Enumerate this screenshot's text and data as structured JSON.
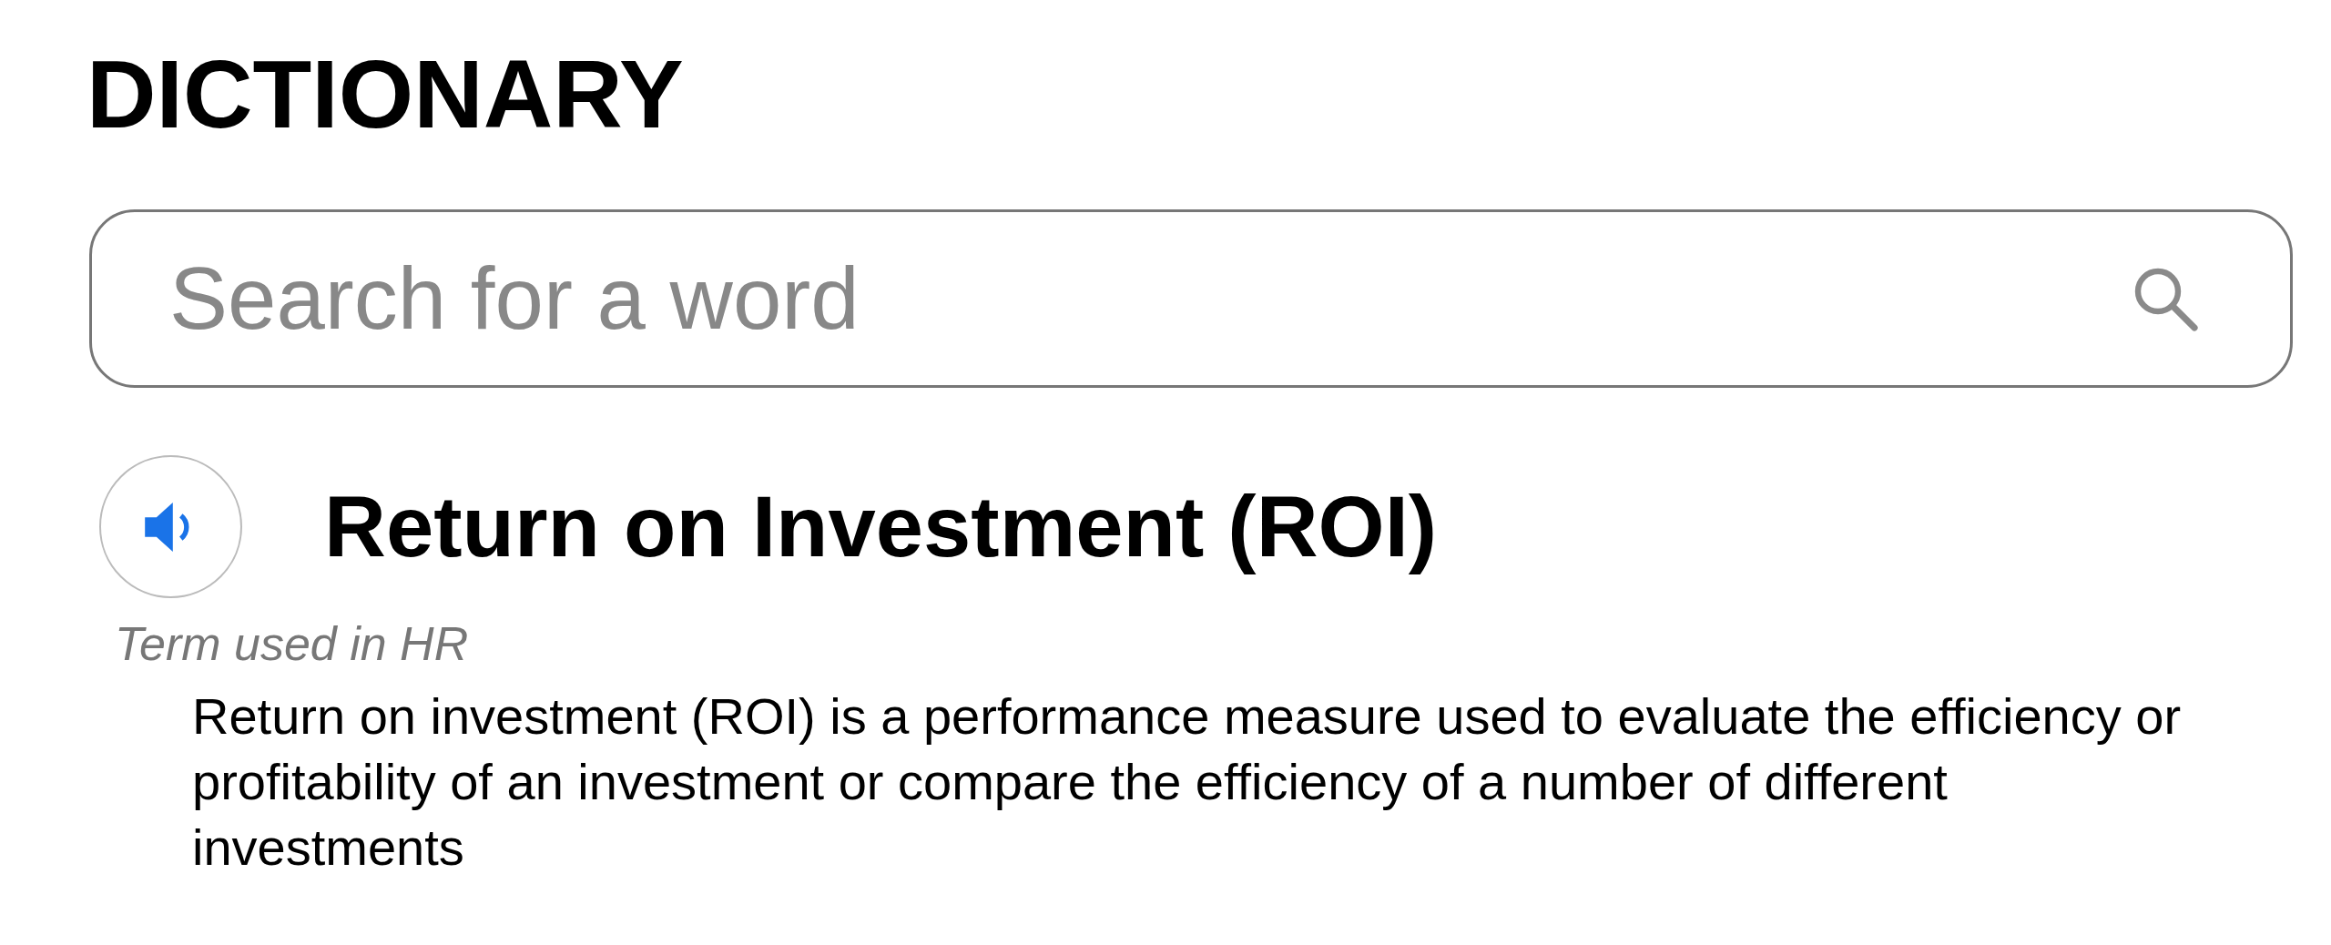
{
  "title": "DICTIONARY",
  "search": {
    "placeholder": "Search for a word"
  },
  "entry": {
    "term": "Return on Investment (ROI)",
    "usage": "Term used in HR",
    "definition": "Return on investment (ROI) is a performance measure used to evaluate the efficiency or profitability of an investment or compare the efficiency of a number of different investments"
  }
}
